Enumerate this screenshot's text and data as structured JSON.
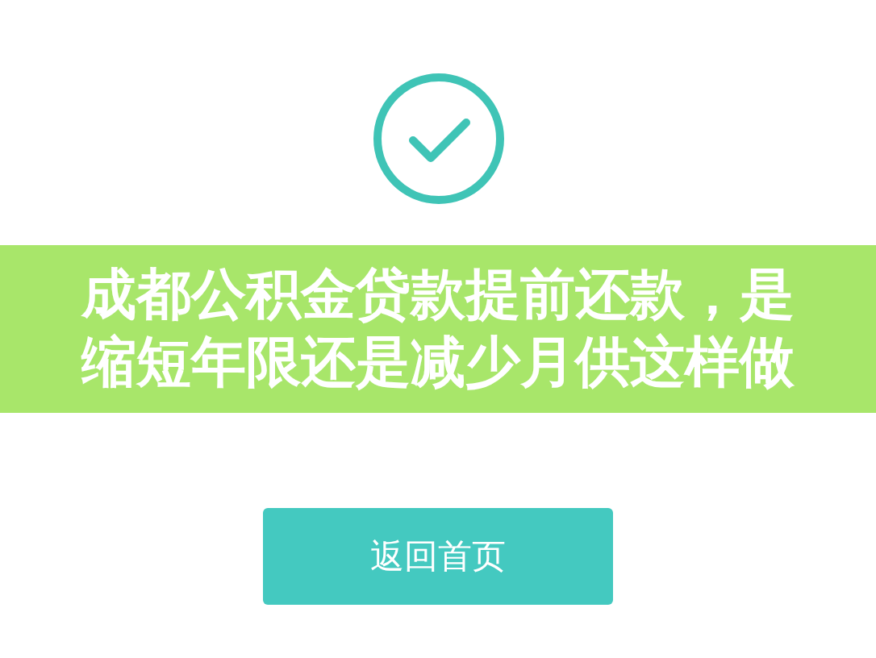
{
  "status": {
    "kind": "success"
  },
  "banner": {
    "lines": [
      "成都公积金贷款提前还款，是",
      "缩短年限还是减少月供这样做"
    ]
  },
  "button": {
    "label": "返回首页"
  }
}
